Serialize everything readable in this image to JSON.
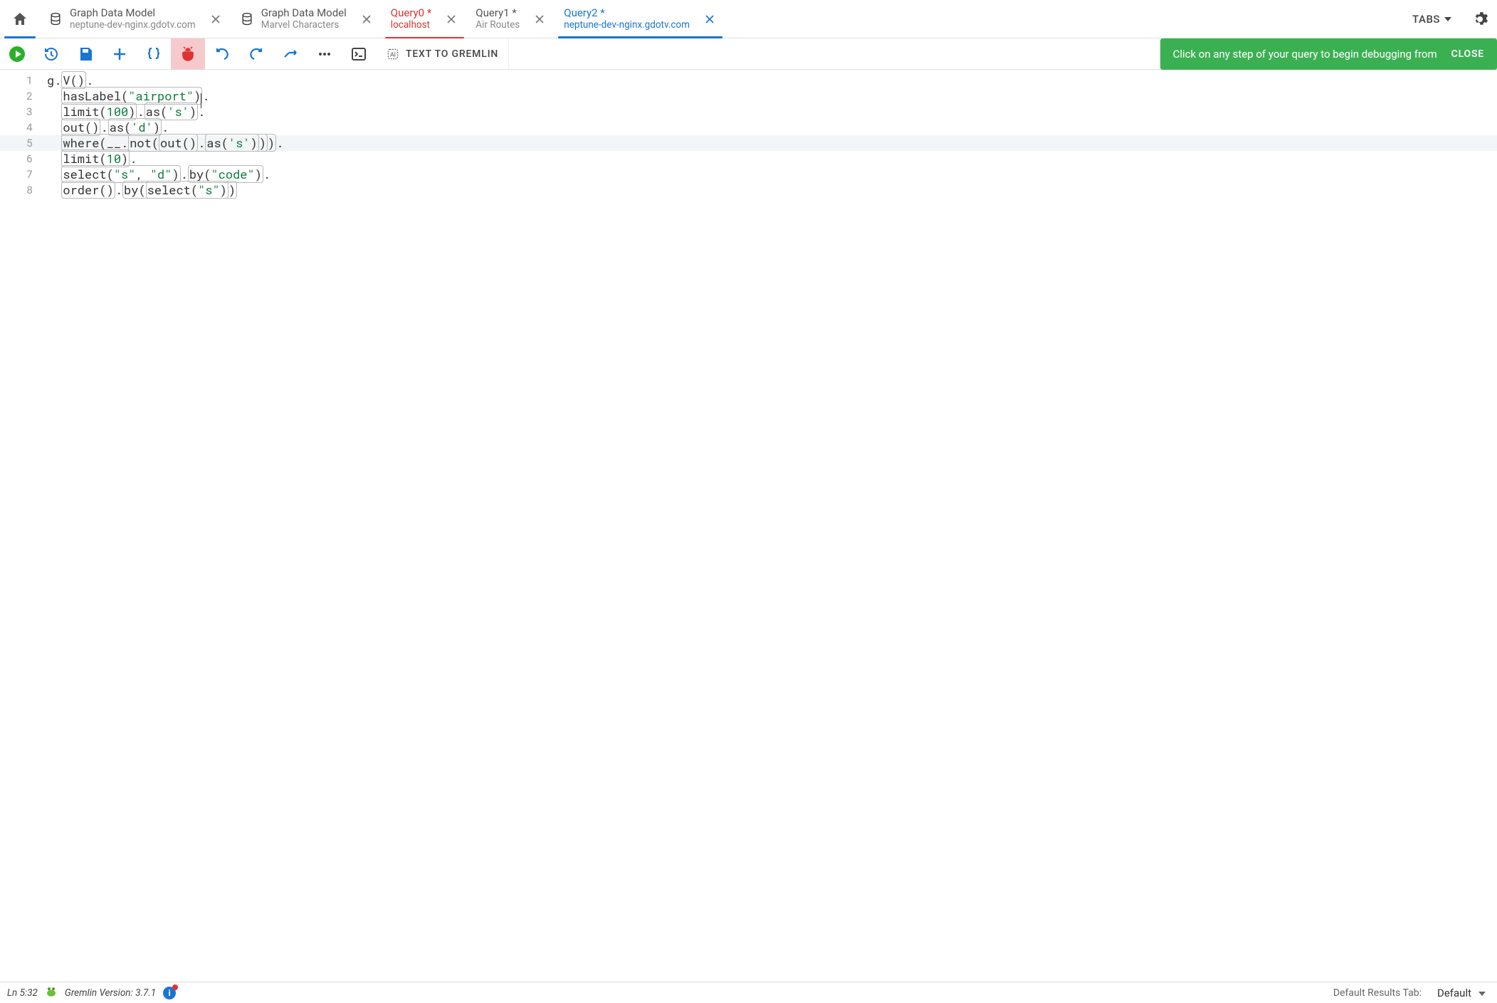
{
  "tabs": [
    {
      "title": "Graph Data Model",
      "sub": "neptune-dev-nginx.gdotv.com"
    },
    {
      "title": "Graph Data Model",
      "sub": "Marvel Characters"
    },
    {
      "title": "Query0 *",
      "sub": "localhost"
    },
    {
      "title": "Query1 *",
      "sub": "Air Routes"
    },
    {
      "title": "Query2 *",
      "sub": "neptune-dev-nginx.gdotv.com"
    }
  ],
  "tabs_menu_label": "TABS",
  "toolbar": {
    "text_to_gremlin": "TEXT TO GREMLIN"
  },
  "hint": {
    "message": "Click on any step of your query to begin debugging from",
    "close": "CLOSE"
  },
  "editor": {
    "line_numbers": [
      "1",
      "2",
      "3",
      "4",
      "5",
      "6",
      "7",
      "8"
    ],
    "code": {
      "l1_g": "g",
      "l1_V": "V",
      "l2_hasLabel": "hasLabel",
      "l2_airport": "\"airport\"",
      "l3_limit": "limit",
      "l3_100": "100",
      "l3_as": "as",
      "l3_s": "'s'",
      "l4_out": "out",
      "l4_as": "as",
      "l4_d": "'d'",
      "l5_where": "where",
      "l5_under": "__",
      "l5_not": "not",
      "l5_out": "out",
      "l5_as": "as",
      "l5_s": "'s'",
      "l6_limit": "limit",
      "l6_10": "10",
      "l7_select": "select",
      "l7_s": "\"s\"",
      "l7_d": "\"d\"",
      "l7_by": "by",
      "l7_code": "\"code\"",
      "l8_order": "order",
      "l8_by": "by",
      "l8_select": "select",
      "l8_s": "\"s\""
    }
  },
  "status": {
    "cursor": "Ln 5:32",
    "version": "Gremlin Version: 3.7.1",
    "results_label": "Default Results Tab:",
    "results_value": "Default"
  }
}
